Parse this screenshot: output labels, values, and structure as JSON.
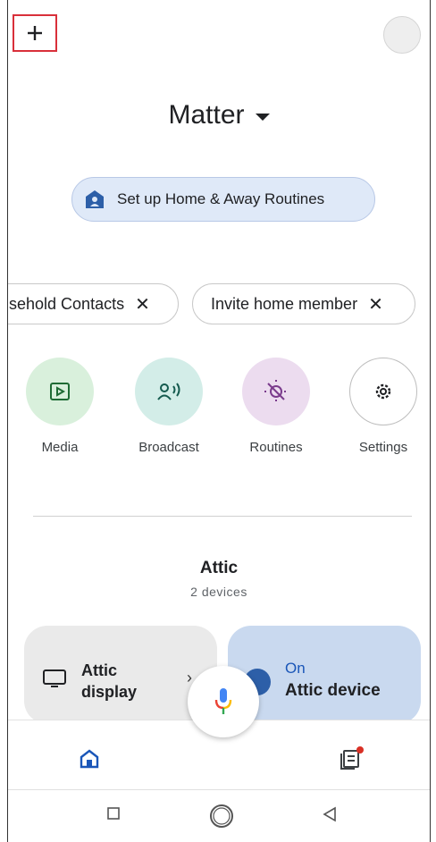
{
  "home": {
    "title": "Matter"
  },
  "routine_banner": {
    "label": "Set up Home & Away Routines"
  },
  "chips": [
    {
      "label": "sehold Contacts",
      "close": "✕"
    },
    {
      "label": "Invite home member",
      "close": "✕"
    }
  ],
  "actions": [
    {
      "label": "Media"
    },
    {
      "label": "Broadcast"
    },
    {
      "label": "Routines"
    },
    {
      "label": "Settings"
    }
  ],
  "room": {
    "name": "Attic",
    "count": "2 devices"
  },
  "devices": [
    {
      "name": "Attic display",
      "chevron": "›"
    },
    {
      "status": "On",
      "name": "Attic device"
    }
  ],
  "colors": {
    "media_bg": "#d9f0dc",
    "broadcast_bg": "#d3ede8",
    "routines_bg": "#ecdcef",
    "device_on_bg": "#c9d9ef",
    "accent_blue": "#1a56b8",
    "notification_red": "#d93025"
  }
}
